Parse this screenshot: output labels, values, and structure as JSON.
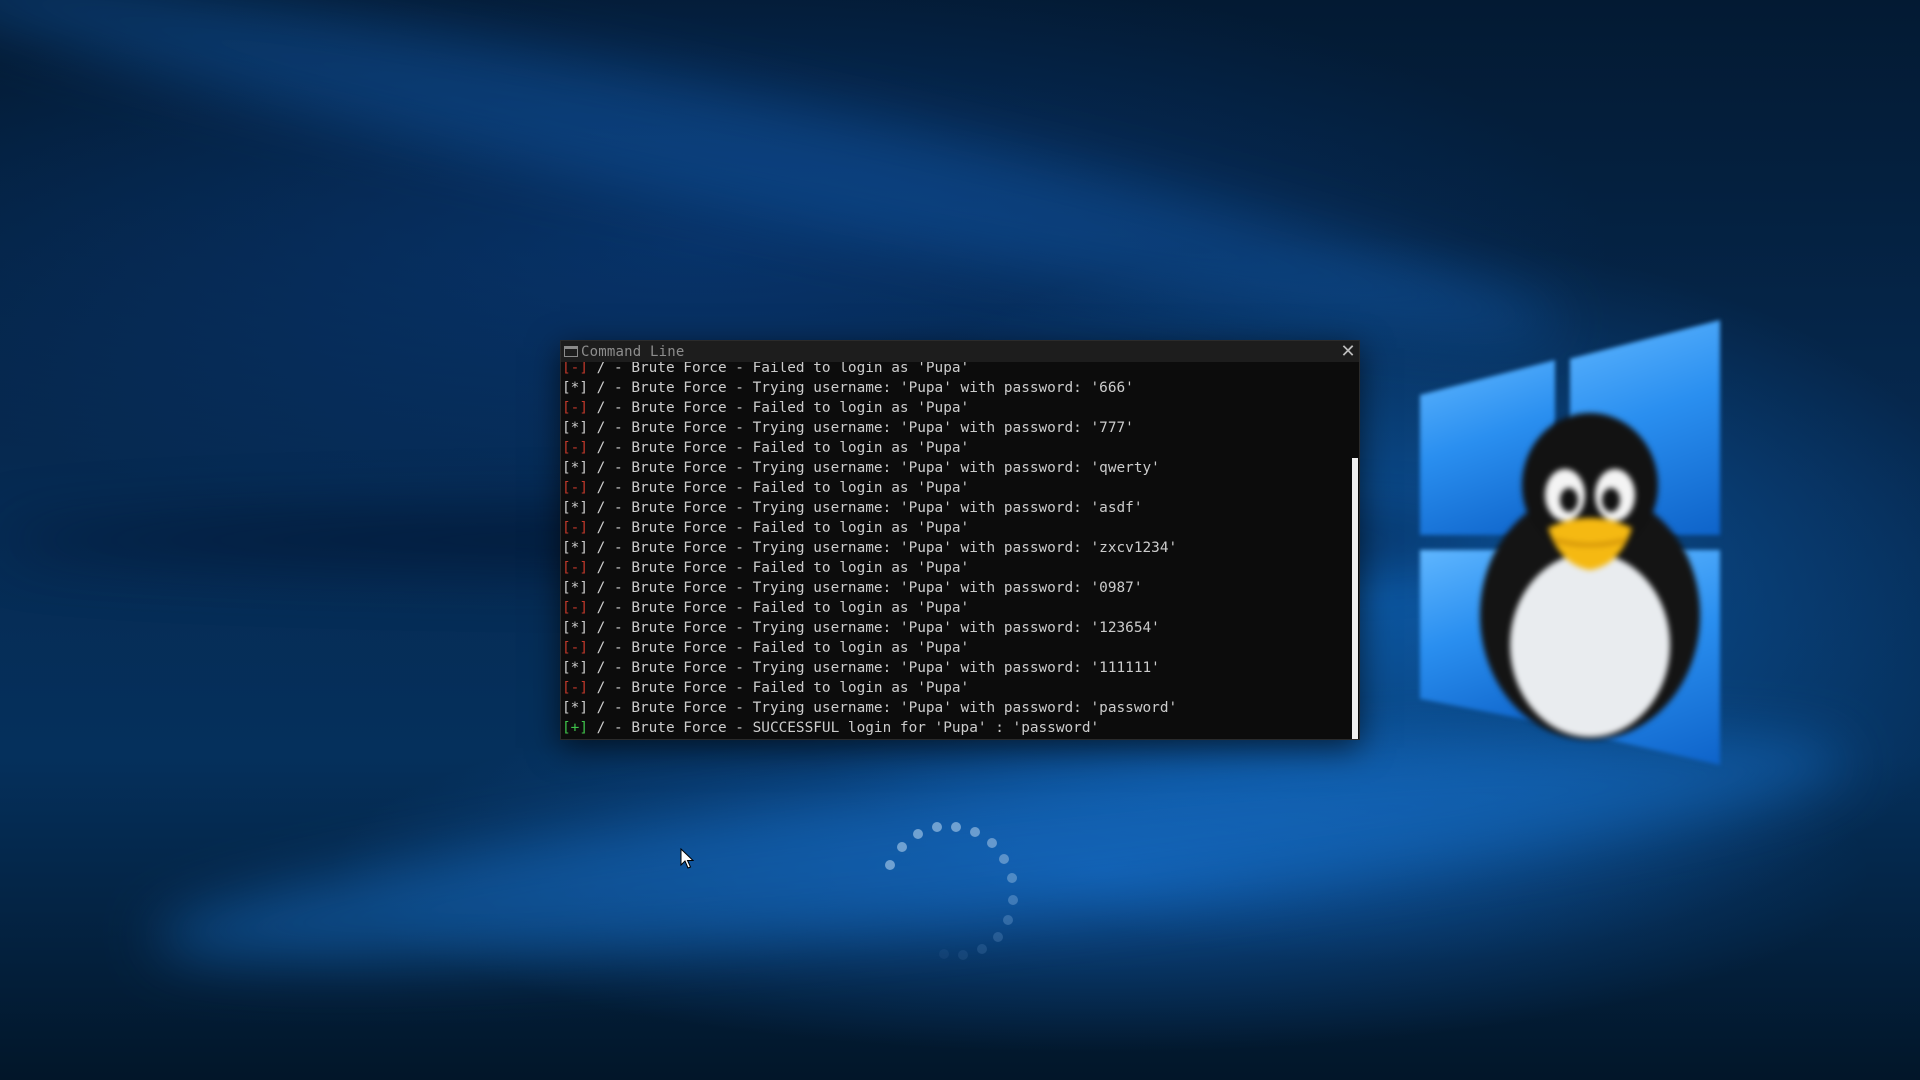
{
  "desktop": {
    "wallpaper": "windows-10-hero-with-tux-penguin",
    "accent": "#1a7fe0"
  },
  "terminal": {
    "title": "Command Line",
    "close_label": "✕",
    "lines": [
      {
        "tag": "[-]",
        "type": "fail",
        "text": " / - Brute Force - Failed to login as 'Pupa'"
      },
      {
        "tag": "[*]",
        "type": "info",
        "text": " / - Brute Force - Trying username: 'Pupa' with password: '666'"
      },
      {
        "tag": "[-]",
        "type": "fail",
        "text": " / - Brute Force - Failed to login as 'Pupa'"
      },
      {
        "tag": "[*]",
        "type": "info",
        "text": " / - Brute Force - Trying username: 'Pupa' with password: '777'"
      },
      {
        "tag": "[-]",
        "type": "fail",
        "text": " / - Brute Force - Failed to login as 'Pupa'"
      },
      {
        "tag": "[*]",
        "type": "info",
        "text": " / - Brute Force - Trying username: 'Pupa' with password: 'qwerty'"
      },
      {
        "tag": "[-]",
        "type": "fail",
        "text": " / - Brute Force - Failed to login as 'Pupa'"
      },
      {
        "tag": "[*]",
        "type": "info",
        "text": " / - Brute Force - Trying username: 'Pupa' with password: 'asdf'"
      },
      {
        "tag": "[-]",
        "type": "fail",
        "text": " / - Brute Force - Failed to login as 'Pupa'"
      },
      {
        "tag": "[*]",
        "type": "info",
        "text": " / - Brute Force - Trying username: 'Pupa' with password: 'zxcv1234'"
      },
      {
        "tag": "[-]",
        "type": "fail",
        "text": " / - Brute Force - Failed to login as 'Pupa'"
      },
      {
        "tag": "[*]",
        "type": "info",
        "text": " / - Brute Force - Trying username: 'Pupa' with password: '0987'"
      },
      {
        "tag": "[-]",
        "type": "fail",
        "text": " / - Brute Force - Failed to login as 'Pupa'"
      },
      {
        "tag": "[*]",
        "type": "info",
        "text": " / - Brute Force - Trying username: 'Pupa' with password: '123654'"
      },
      {
        "tag": "[-]",
        "type": "fail",
        "text": " / - Brute Force - Failed to login as 'Pupa'"
      },
      {
        "tag": "[*]",
        "type": "info",
        "text": " / - Brute Force - Trying username: 'Pupa' with password: '111111'"
      },
      {
        "tag": "[-]",
        "type": "fail",
        "text": " / - Brute Force - Failed to login as 'Pupa'"
      },
      {
        "tag": "[*]",
        "type": "info",
        "text": " / - Brute Force - Trying username: 'Pupa' with password: 'password'"
      },
      {
        "tag": "[+]",
        "type": "ok",
        "text": " / - Brute Force - SUCCESSFUL login for 'Pupa' : 'password'"
      }
    ],
    "colors": {
      "fail": "#c0392b",
      "ok": "#3fc24a",
      "info": "#cccccc",
      "background": "#0c0c0c"
    }
  }
}
